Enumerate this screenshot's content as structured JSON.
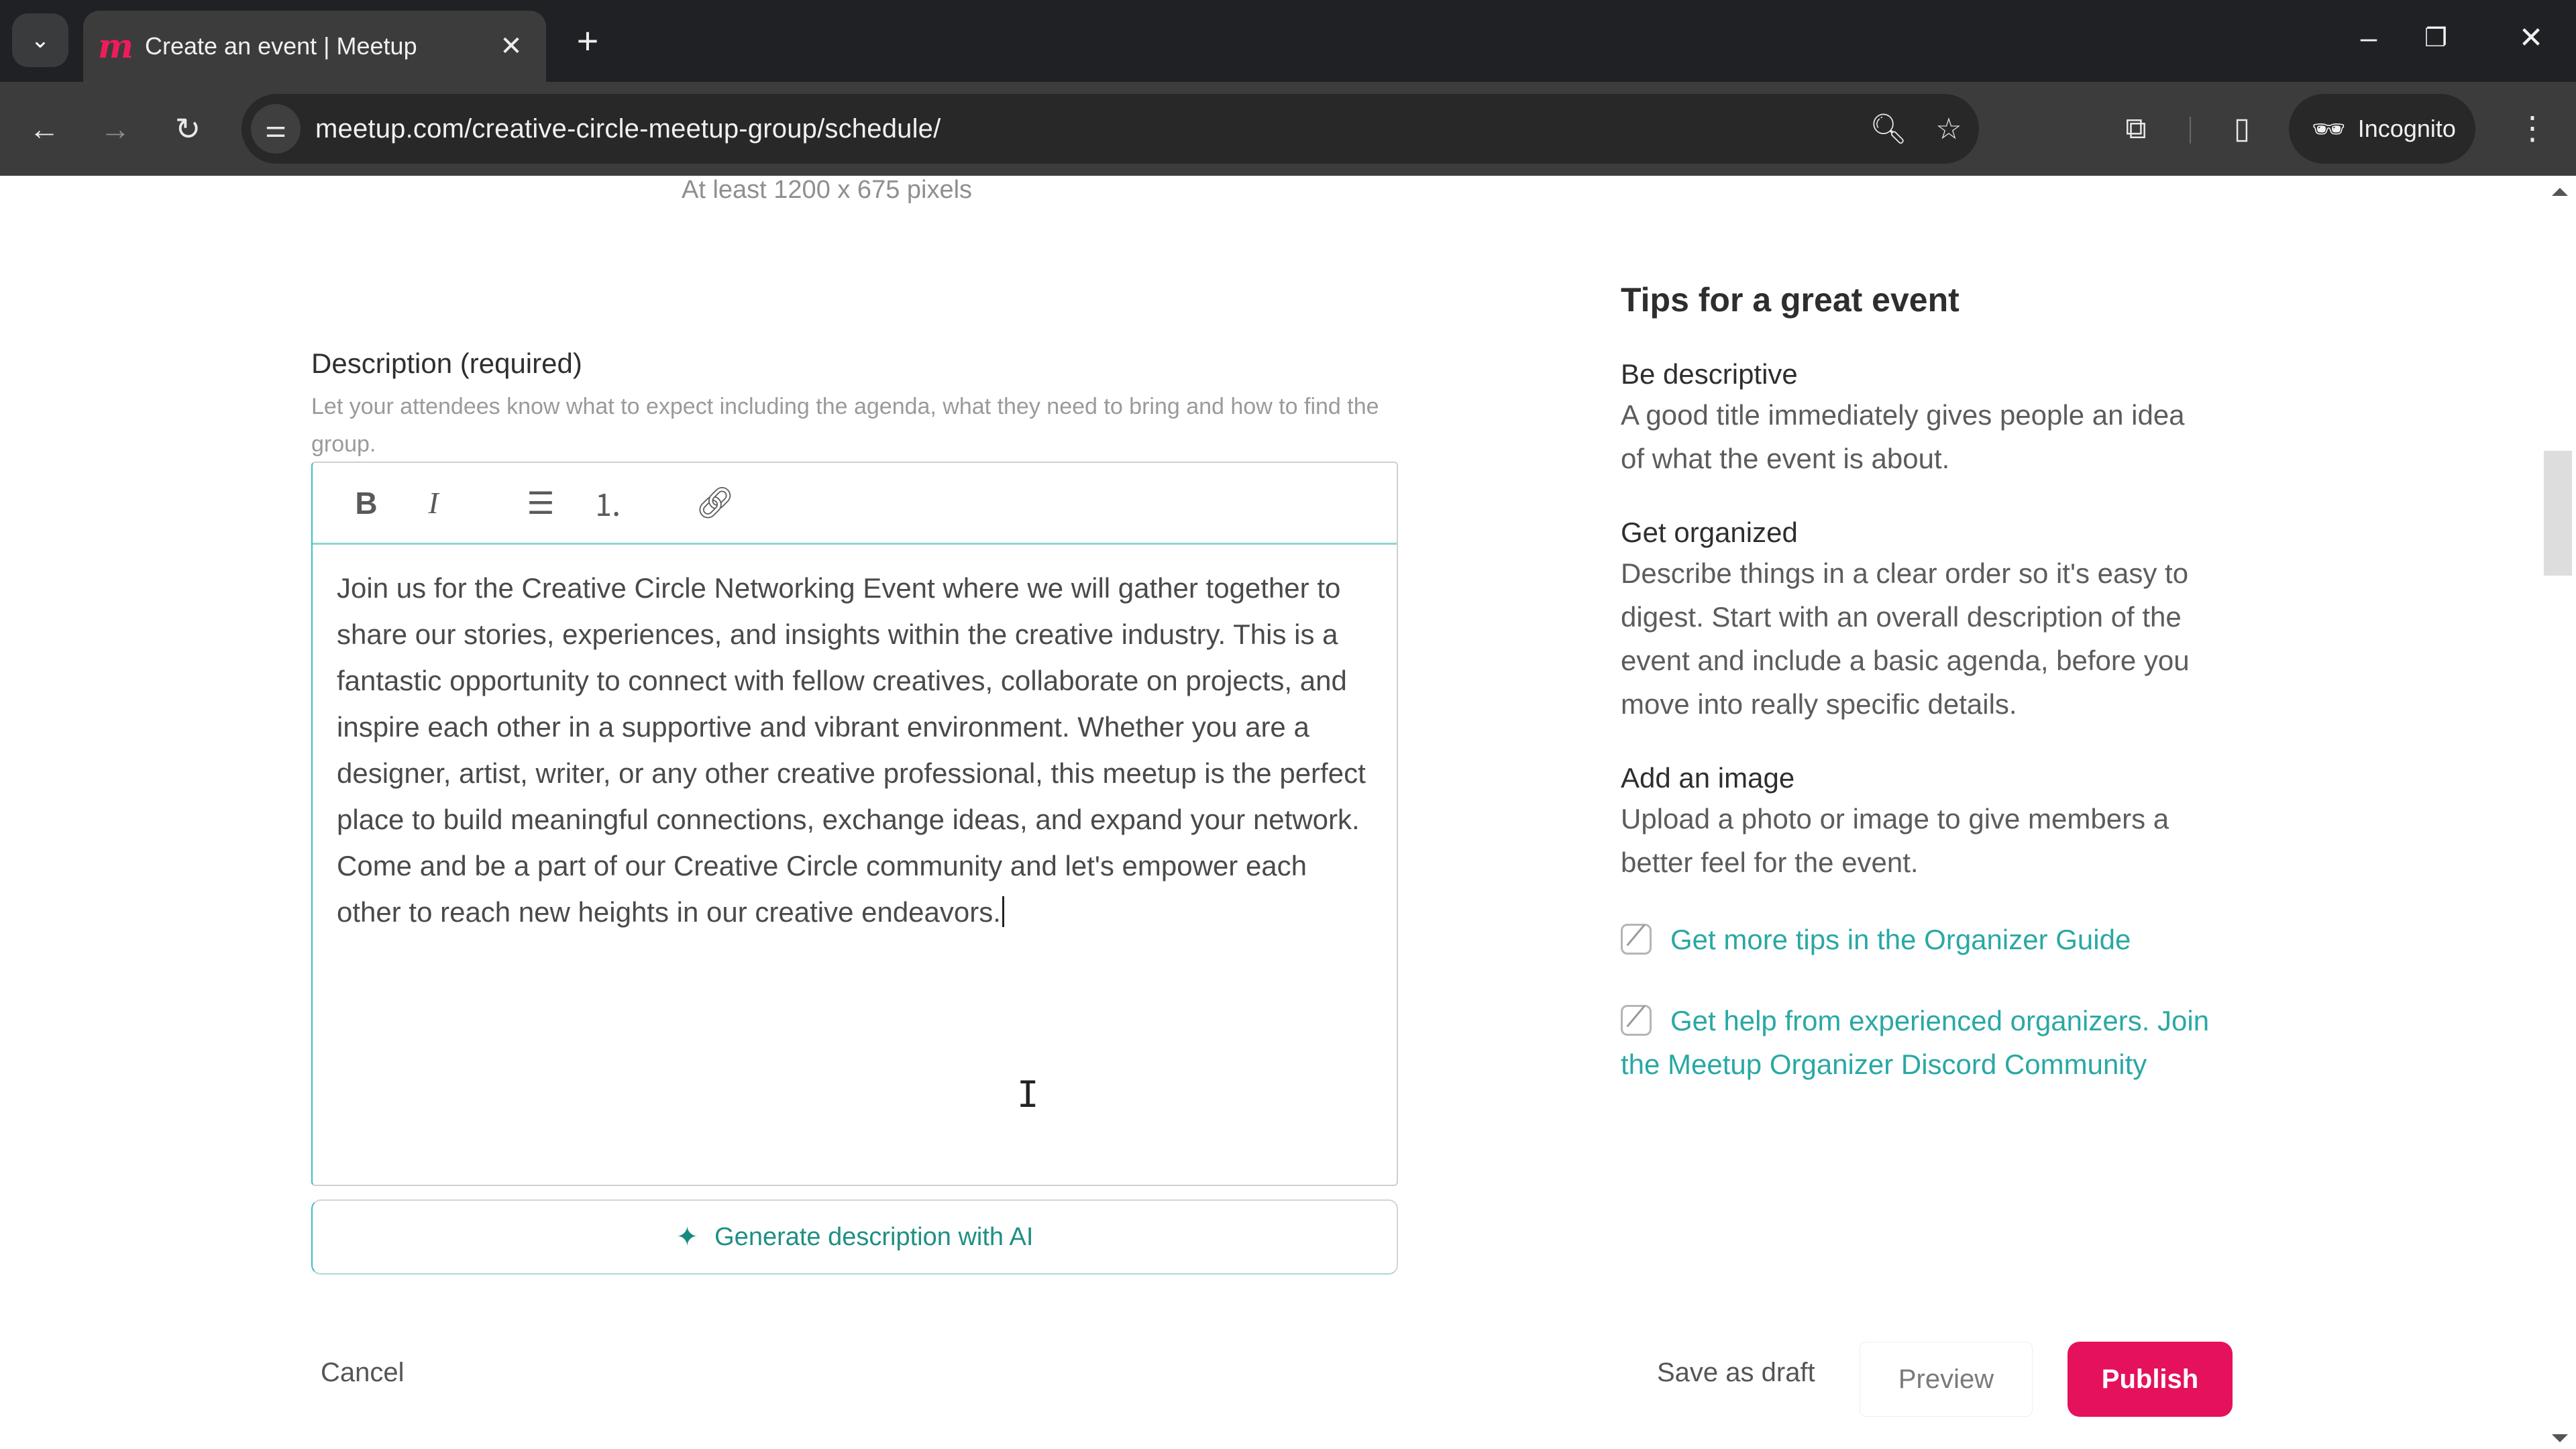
{
  "browser": {
    "tab_list_icon": "chevron-down-icon",
    "tab": {
      "favicon": "meetup-logo",
      "favicon_glyph": "m",
      "title": "Create an event | Meetup",
      "close_glyph": "✕"
    },
    "new_tab_glyph": "+",
    "window_controls": {
      "minimize": "–",
      "restore": "❐",
      "close": "✕"
    },
    "nav": {
      "back": "←",
      "forward": "→",
      "reload": "↻"
    },
    "url": "meetup.com/creative-circle-meetup-group/schedule/",
    "site_info_glyph": "⚌",
    "zoom_glyph": "🔍︎",
    "bookmark_glyph": "☆",
    "extensions_glyph": "⧉",
    "sidepanel_glyph": "▯",
    "incognito": {
      "glyph": "🕶︎",
      "label": "Incognito"
    },
    "menu_glyph": "⋮"
  },
  "page": {
    "upload_hint": "At least 1200 x 675 pixels",
    "description": {
      "label": "Description (required)",
      "help": "Let your attendees know what to expect  including the agenda, what they need to bring and how to find the group.",
      "toolbar": {
        "bold": "B",
        "italic": "I",
        "bullet_list": "☰",
        "numbered_list": "⒈",
        "link": "🔗︎"
      },
      "value": "Join us for the Creative Circle Networking Event where we will gather together to share our stories, experiences, and insights within the creative industry. This is a fantastic opportunity to connect with fellow creatives, collaborate on projects, and inspire each other in a supportive and vibrant environment. Whether you are a designer, artist, writer, or any other creative professional, this meetup is the perfect place to build meaningful connections, exchange ideas, and expand your network. Come and be a part of our Creative Circle community and let's empower each other to reach new heights in our creative endeavors."
    },
    "ai_button": {
      "icon": "sparkle-icon",
      "glyph": "✦",
      "label": "Generate description with AI"
    },
    "actions": {
      "cancel": "Cancel",
      "save_draft": "Save as draft",
      "preview": "Preview",
      "publish": "Publish"
    },
    "tips": {
      "title": "Tips for a great event",
      "items": [
        {
          "heading": "Be descriptive",
          "body": "A good title immediately gives people an idea of what the event is about."
        },
        {
          "heading": "Get organized",
          "body": "Describe things in a clear order so it's easy to digest. Start with an overall description of the event and include a basic agenda, before you move into really specific details."
        },
        {
          "heading": "Add an image",
          "body": "Upload a photo or image to give members a better feel for the event."
        }
      ],
      "links": [
        {
          "label": "Get more tips in the Organizer Guide"
        },
        {
          "label": "Get help from experienced organizers. Join the Meetup Organizer Discord Community"
        }
      ]
    },
    "cursor_glyph": "I"
  },
  "colors": {
    "publish": "#e5115d",
    "link_teal": "#2aa8a4",
    "ai_teal": "#1f8f84",
    "chrome_dark": "#202124",
    "chrome_toolbar": "#3c3c3c"
  }
}
